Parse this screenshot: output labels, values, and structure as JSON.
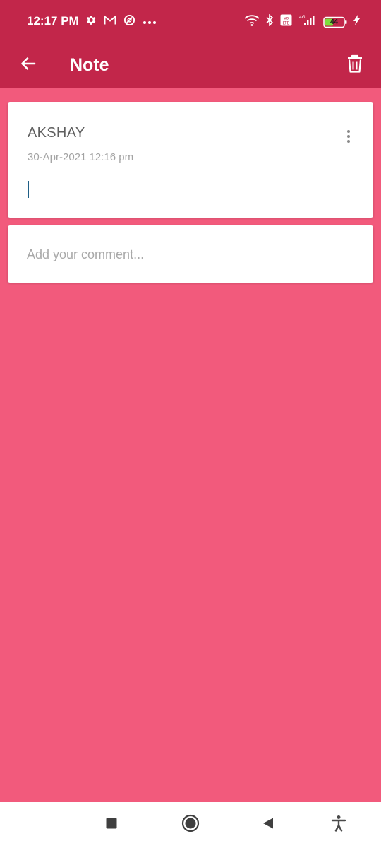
{
  "status_bar": {
    "time": "12:17 PM",
    "battery_level": "44",
    "left_icons": [
      "settings-gear-icon",
      "gmail-icon",
      "data-saver-icon",
      "more-dots-icon"
    ],
    "right_icons": [
      "wifi-icon",
      "bluetooth-icon",
      "volte-icon",
      "4g-signal-icon",
      "battery-icon",
      "charging-bolt-icon"
    ]
  },
  "app_bar": {
    "title": "Note",
    "back_icon": "arrow-left-icon",
    "delete_icon": "trash-icon"
  },
  "note": {
    "author": "AKSHAY",
    "timestamp": "30-Apr-2021 12:16 pm",
    "body": ""
  },
  "comment": {
    "placeholder": "Add your comment...",
    "value": ""
  },
  "nav_bar": {
    "buttons": [
      "recents-square-icon",
      "home-circle-icon",
      "back-triangle-icon",
      "accessibility-icon"
    ]
  },
  "colors": {
    "primary_dark": "#c2264a",
    "background": "#f25a7c",
    "card": "#ffffff",
    "cursor": "#1f5f86"
  }
}
